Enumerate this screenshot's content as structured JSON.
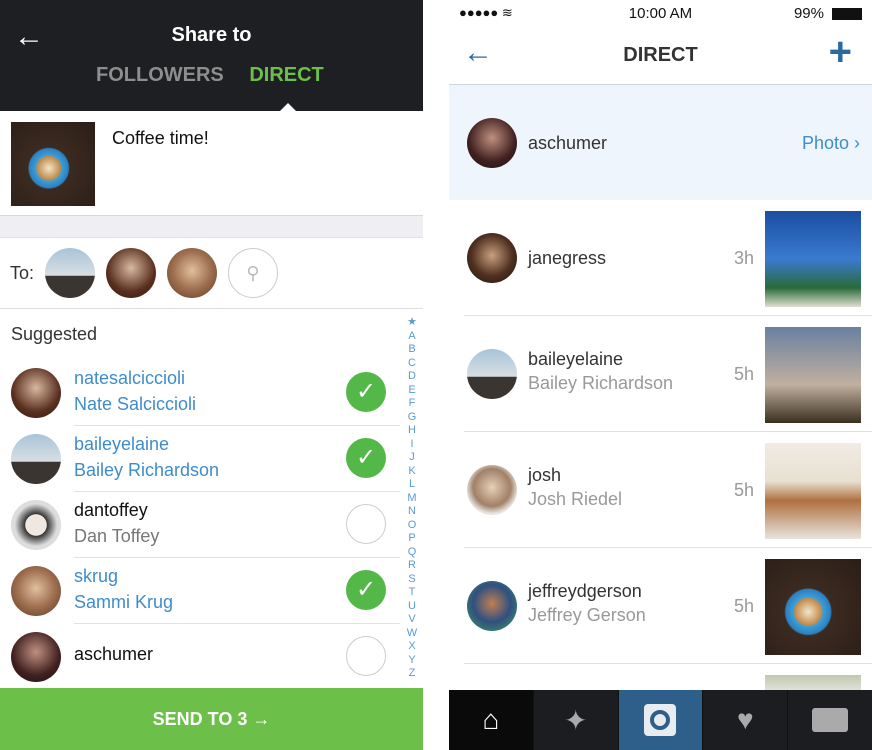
{
  "share": {
    "back_icon": "arrow-left-icon",
    "title": "Share to",
    "tabs": [
      {
        "label": "FOLLOWERS",
        "active": false
      },
      {
        "label": "DIRECT",
        "active": true
      }
    ],
    "caption": "Coffee time!",
    "to_label": "To:",
    "suggested_label": "Suggested",
    "index": [
      "★",
      "A",
      "B",
      "C",
      "D",
      "E",
      "F",
      "G",
      "H",
      "I",
      "J",
      "K",
      "L",
      "M",
      "N",
      "O",
      "P",
      "Q",
      "R",
      "S",
      "T",
      "U",
      "V",
      "W",
      "X",
      "Y",
      "Z"
    ],
    "suggestions": [
      {
        "username": "natesalciccioli",
        "name": "Nate Salciccioli",
        "selected": true
      },
      {
        "username": "baileyelaine",
        "name": "Bailey Richardson",
        "selected": true
      },
      {
        "username": "dantoffey",
        "name": "Dan Toffey",
        "selected": false
      },
      {
        "username": "skrug",
        "name": "Sammi Krug",
        "selected": true
      },
      {
        "username": "aschumer",
        "name": "",
        "selected": false
      }
    ],
    "send_label": "SEND TO 3 →",
    "colors": {
      "accent": "#6cc04a",
      "link": "#3f8ccb",
      "header": "#1e1f22"
    }
  },
  "direct": {
    "status": {
      "time": "10:00 AM",
      "battery": "99%"
    },
    "title": "DIRECT",
    "threads": [
      {
        "username": "aschumer",
        "name": "",
        "time": "",
        "action": "Photo ›",
        "highlight": true
      },
      {
        "username": "janegress",
        "name": "",
        "time": "3h"
      },
      {
        "username": "baileyelaine",
        "name": "Bailey Richardson",
        "time": "5h"
      },
      {
        "username": "josh",
        "name": "Josh Riedel",
        "time": "5h"
      },
      {
        "username": "jeffreydgerson",
        "name": "Jeffrey Gerson",
        "time": "5h"
      }
    ],
    "tabbar": [
      "home-icon",
      "explore-icon",
      "camera-icon",
      "activity-icon",
      "profile-icon"
    ],
    "colors": {
      "accent": "#2a6aa0",
      "highlight": "#eef5fc"
    }
  }
}
